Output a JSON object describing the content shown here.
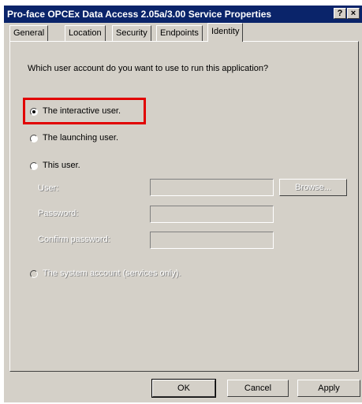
{
  "window": {
    "title": "Pro-face OPCEx Data Access 2.05a/3.00 Service Properties",
    "help_label": "?",
    "close_label": "×"
  },
  "tabs": [
    {
      "label": "General",
      "active": false
    },
    {
      "label": "Location",
      "active": false
    },
    {
      "label": "Security",
      "active": false
    },
    {
      "label": "Endpoints",
      "active": false
    },
    {
      "label": "Identity",
      "active": true
    }
  ],
  "identity": {
    "question": "Which user account do you want to use to run this application?",
    "options": [
      {
        "label": "The interactive user.",
        "selected": true,
        "enabled": true
      },
      {
        "label": "The launching user.",
        "selected": false,
        "enabled": true
      },
      {
        "label": "This user.",
        "selected": false,
        "enabled": true
      },
      {
        "label": "The system account (services only).",
        "selected": false,
        "enabled": false
      }
    ],
    "user_label": "User:",
    "password_label": "Password:",
    "confirm_label": "Confirm password:",
    "browse_label": "Browse..."
  },
  "buttons": {
    "ok": "OK",
    "cancel": "Cancel",
    "apply": "Apply"
  }
}
